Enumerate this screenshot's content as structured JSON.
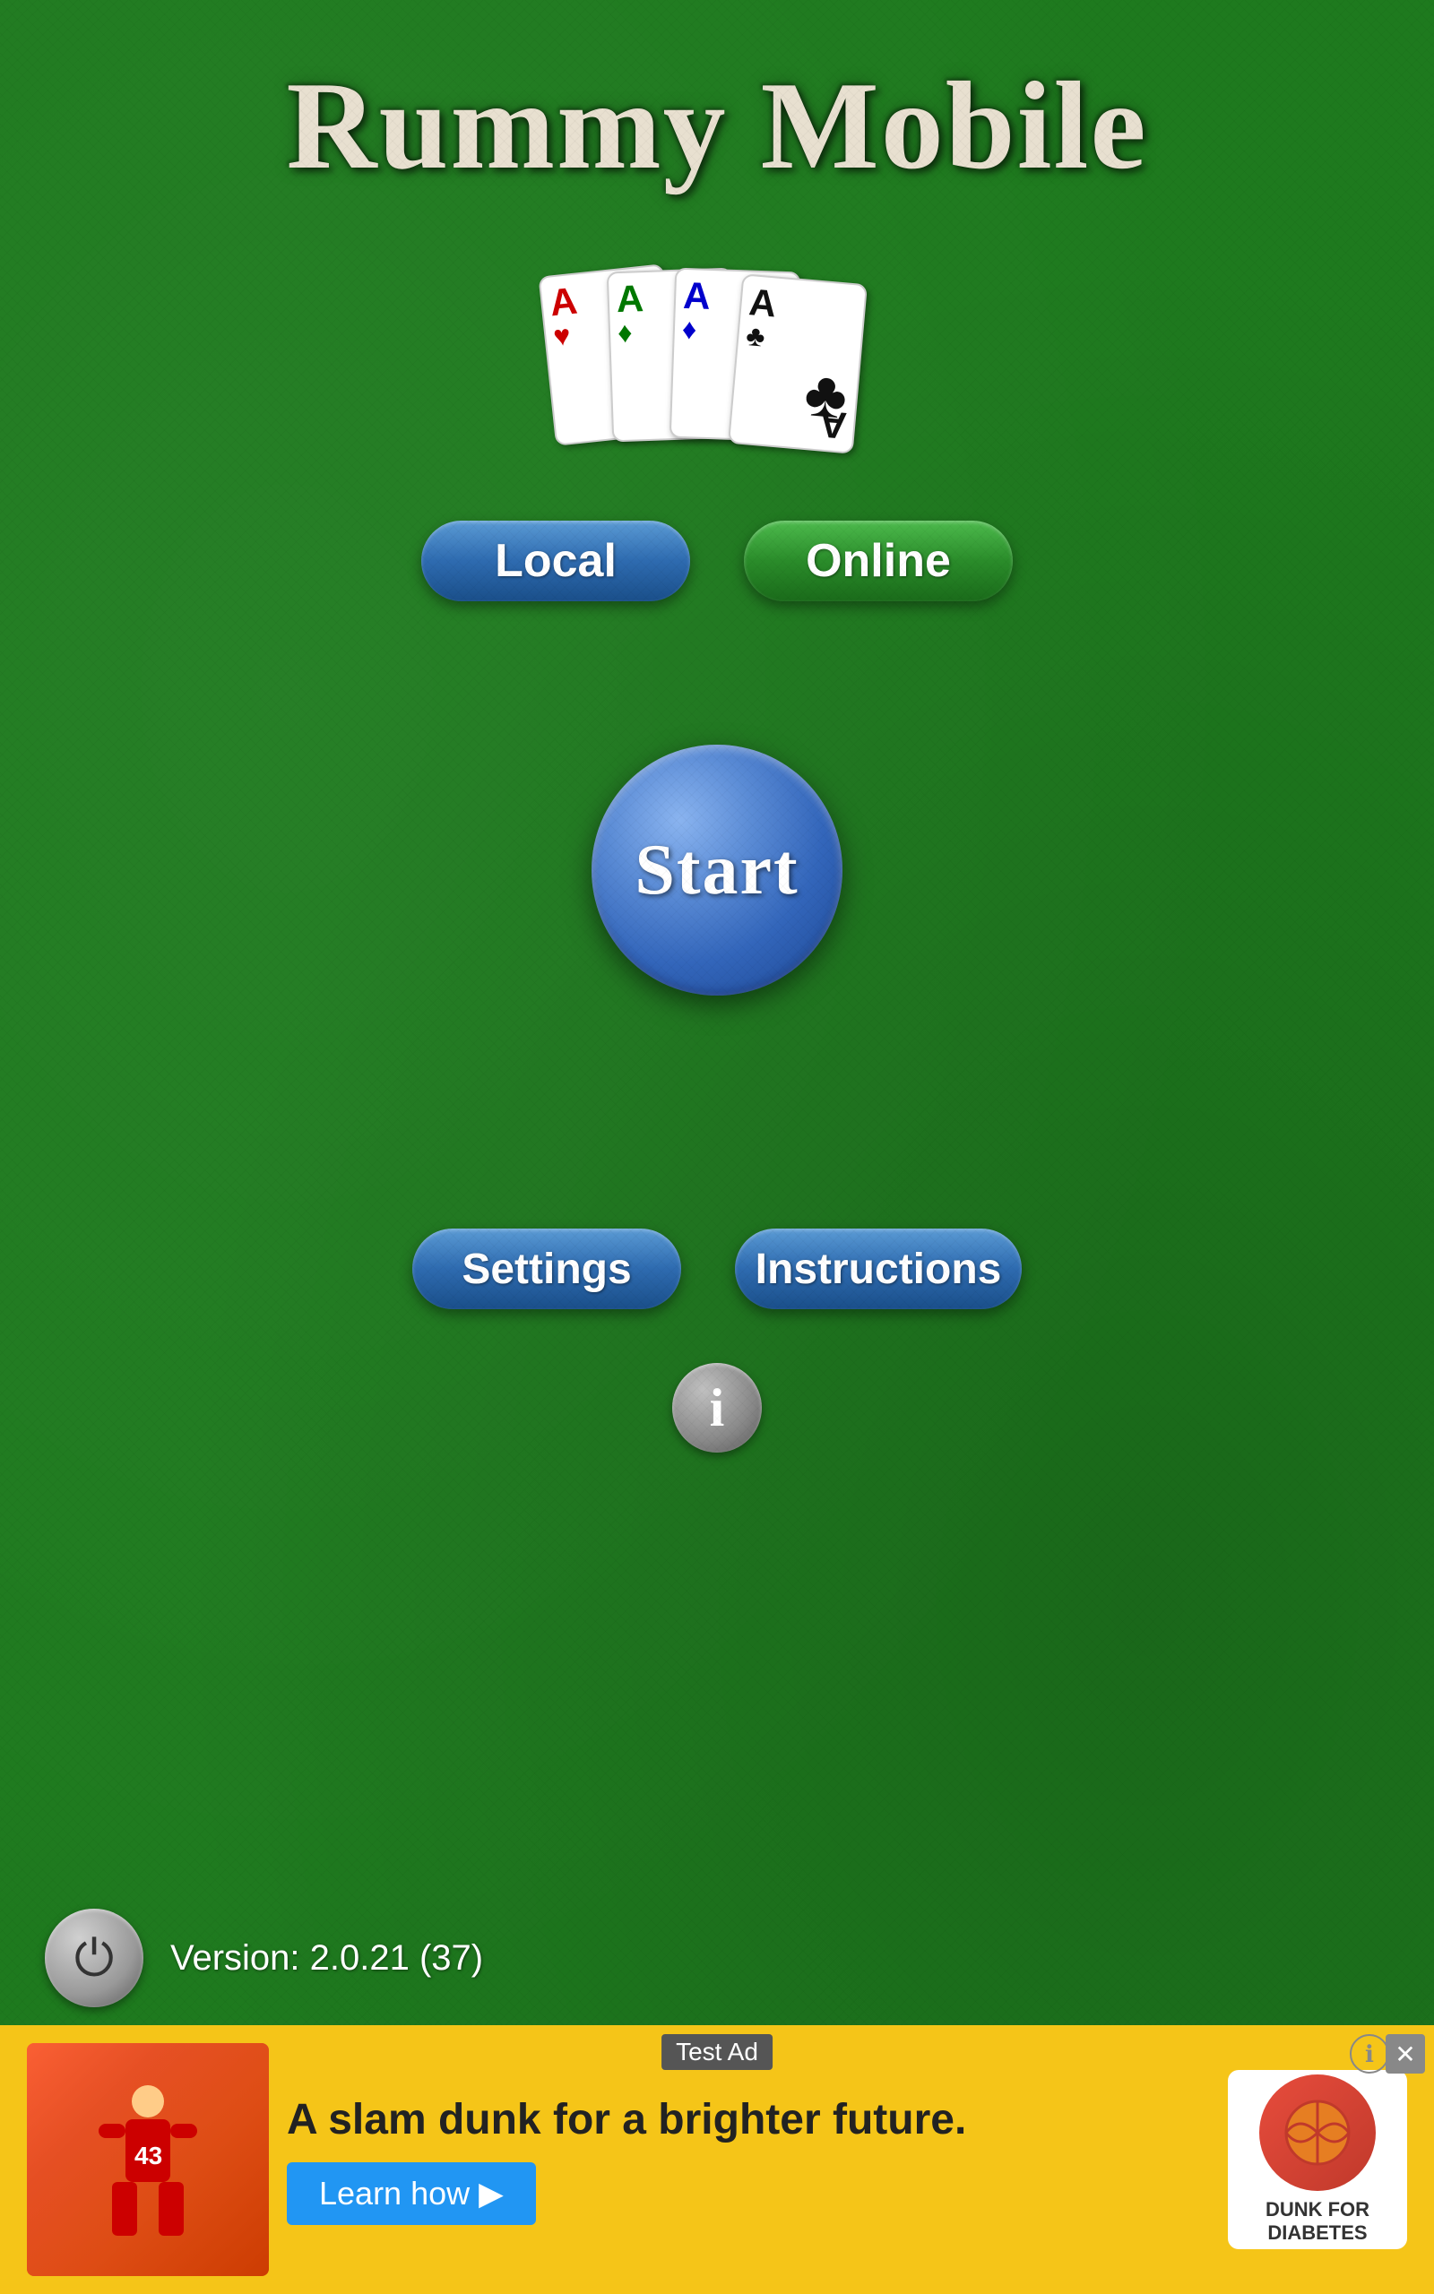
{
  "app": {
    "title": "Rummy Mobile"
  },
  "cards": [
    {
      "letter": "A",
      "suit": "♥",
      "color": "red"
    },
    {
      "letter": "A",
      "suit": "♦",
      "color": "green-suit"
    },
    {
      "letter": "A",
      "suit": "♦",
      "color": "blue-suit"
    },
    {
      "letter": "A",
      "suit": "♣",
      "color": "black"
    }
  ],
  "mode_buttons": {
    "local": "Local",
    "online": "Online"
  },
  "start_button": {
    "label": "Start"
  },
  "action_buttons": {
    "settings": "Settings",
    "instructions": "Instructions"
  },
  "version": {
    "text": "Version: 2.0.21 (37)"
  },
  "ad": {
    "label": "Test Ad",
    "text": "A slam dunk for a brighter future.",
    "learn_btn": "Learn how",
    "logo_text": "DUNK FOR\nDIABETES"
  }
}
